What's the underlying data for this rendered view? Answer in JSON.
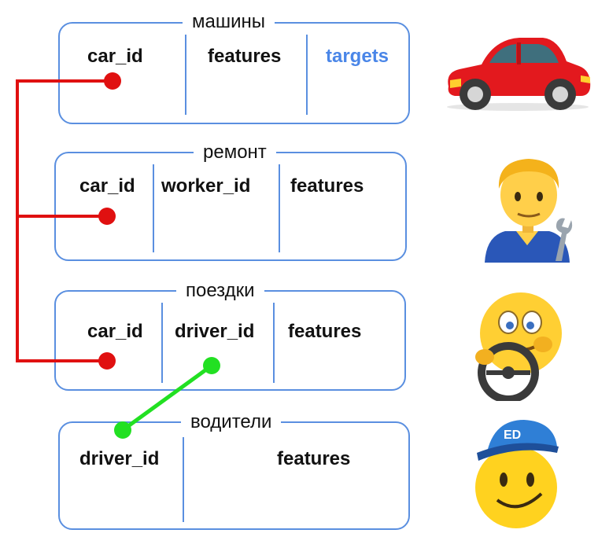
{
  "tables": {
    "cars": {
      "title": "машины",
      "columns": [
        "car_id",
        "features",
        "targets"
      ]
    },
    "repairs": {
      "title": "ремонт",
      "columns": [
        "car_id",
        "worker_id",
        "features"
      ]
    },
    "trips": {
      "title": "поездки",
      "columns": [
        "car_id",
        "driver_id",
        "features"
      ]
    },
    "drivers": {
      "title": "водители",
      "columns": [
        "driver_id",
        "features"
      ]
    }
  },
  "emoji": {
    "cars": "car-icon",
    "repairs": "mechanic-icon",
    "trips": "driving-face-icon",
    "drivers": "driver-face-icon",
    "driver_cap_text": "ED"
  },
  "colors": {
    "border": "#5a8fe0",
    "car_link": "#e01010",
    "driver_link": "#22e022",
    "target": "#4a86e8"
  }
}
